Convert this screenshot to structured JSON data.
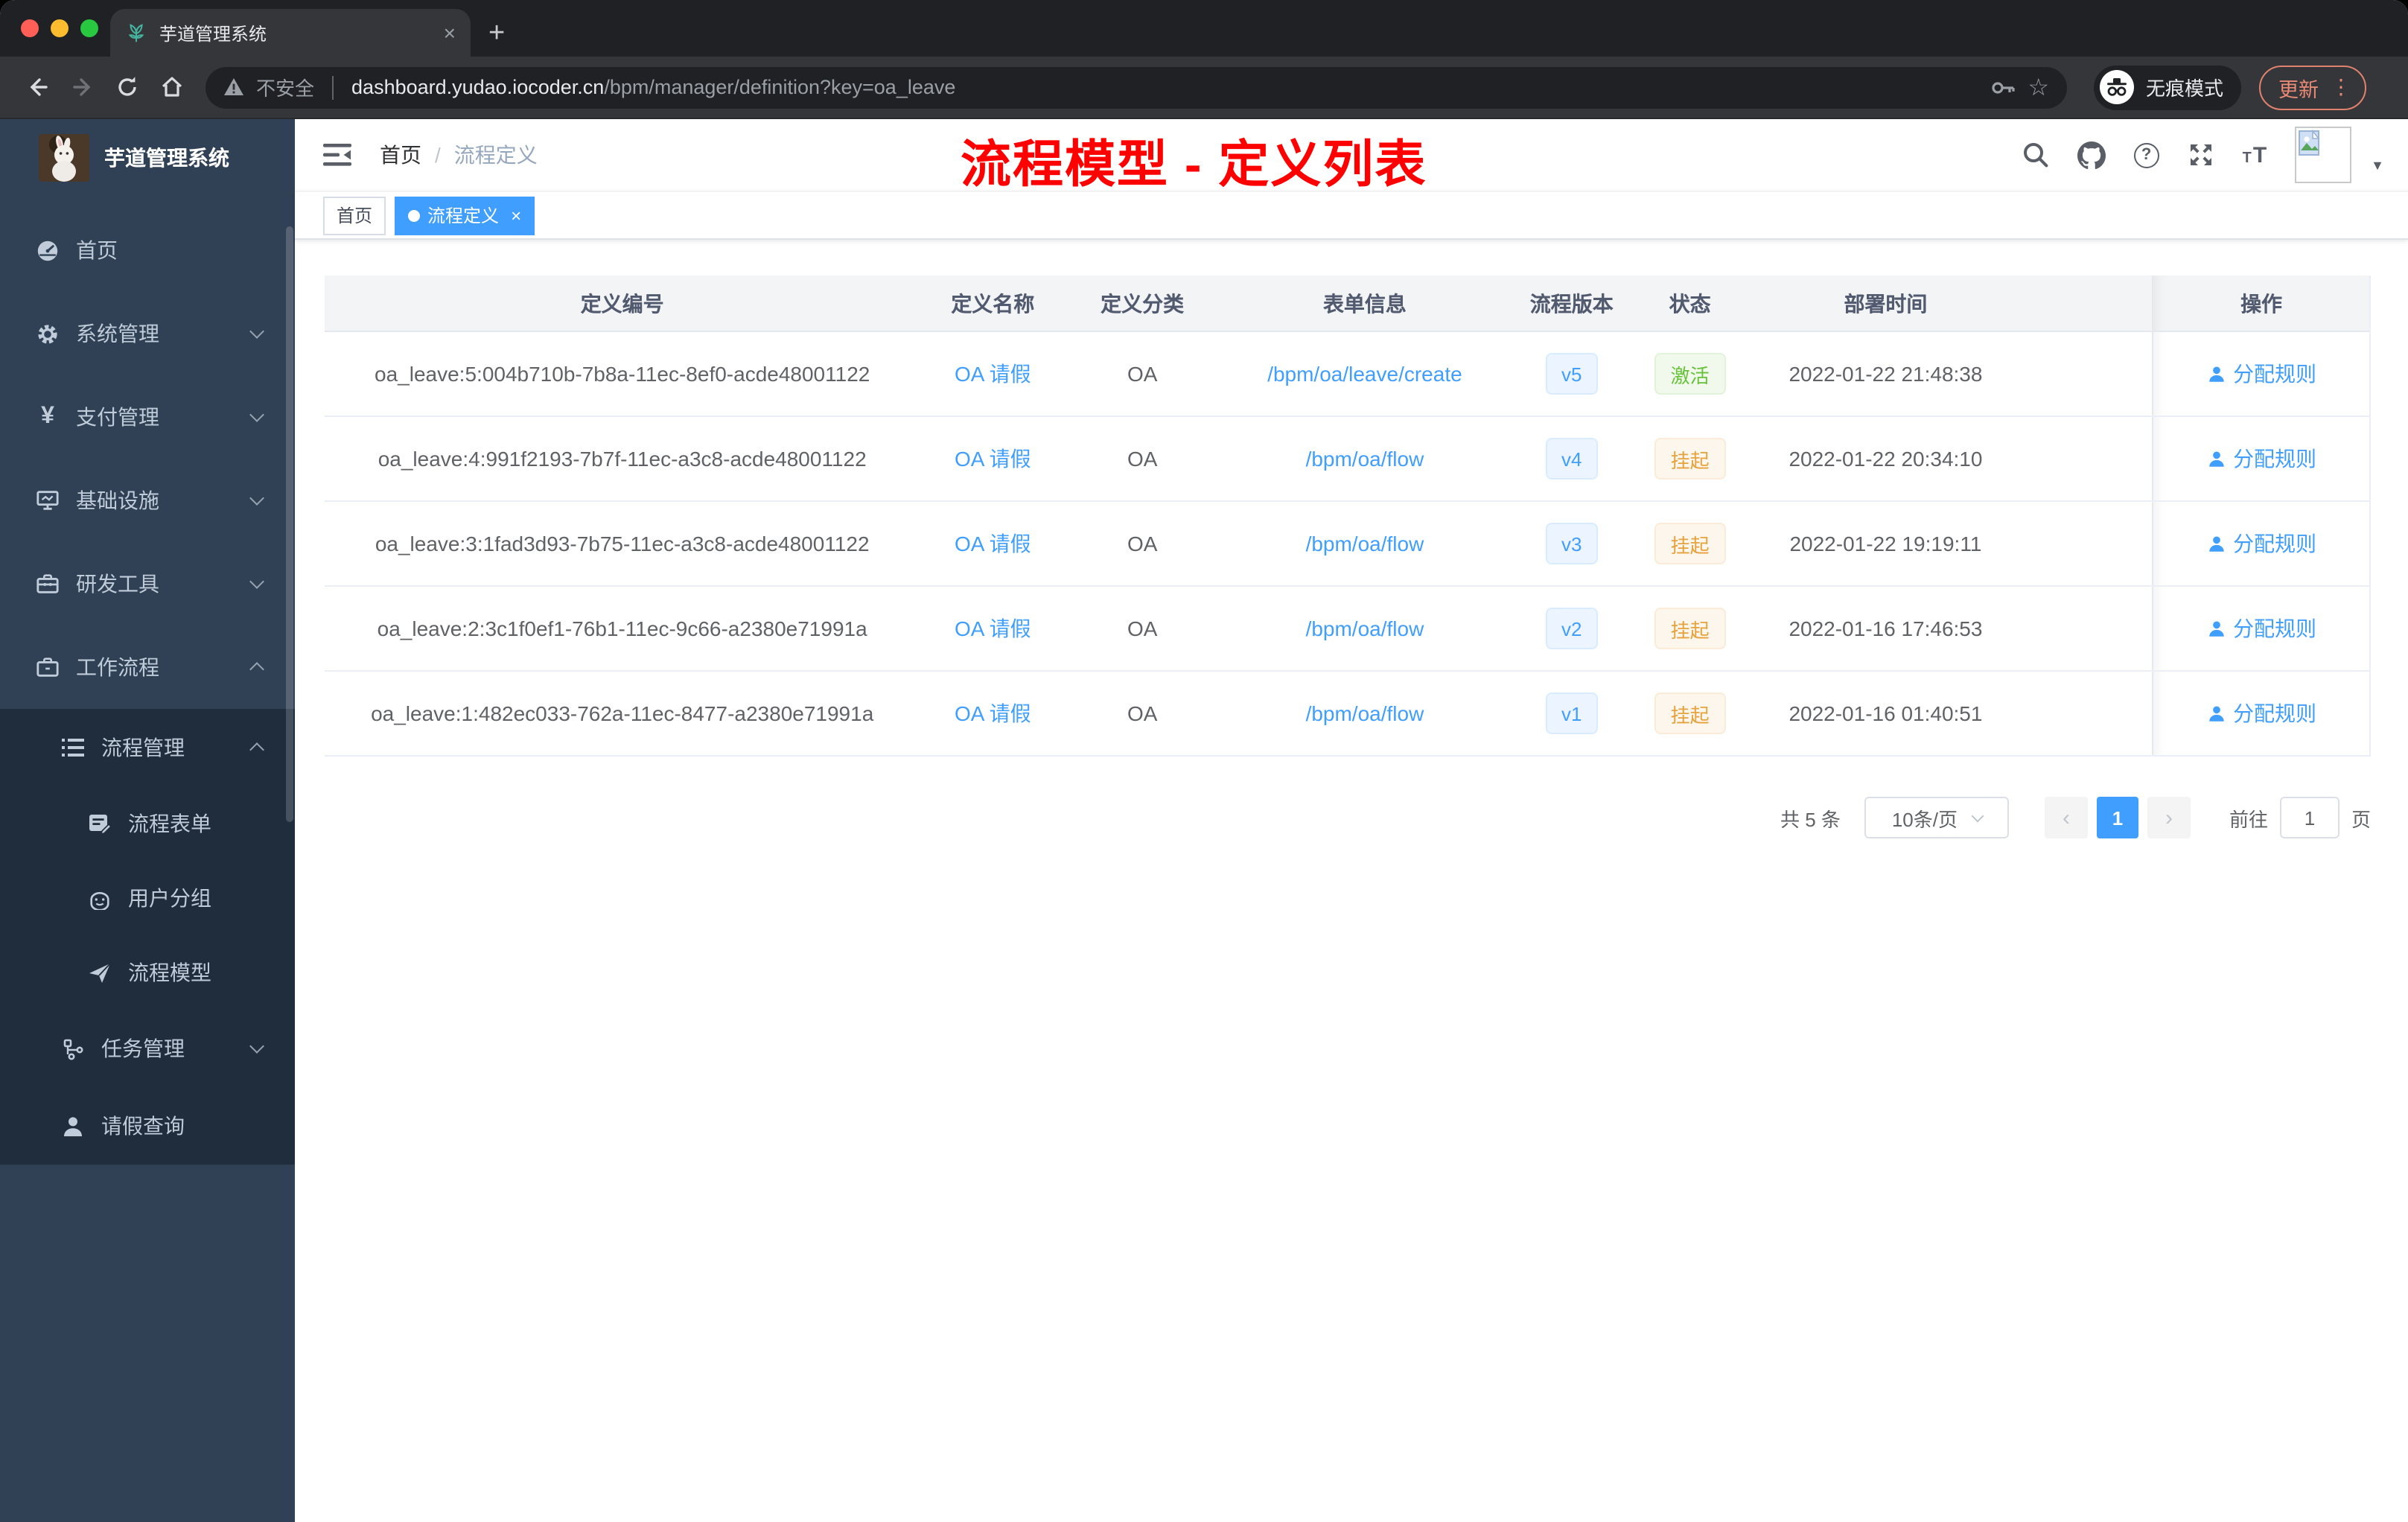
{
  "browser": {
    "tab_title": "芋道管理系统",
    "security_label": "不安全",
    "url_host": "dashboard.yudao.iocoder.cn",
    "url_path": "/bpm/manager/definition?key=oa_leave",
    "incognito_label": "无痕模式",
    "update_label": "更新"
  },
  "icons": {
    "close": "×",
    "plus": "+",
    "star": "☆",
    "menu_dots": "⋮",
    "caret_down": "▼",
    "page_prev": "‹",
    "page_next": "›"
  },
  "sidebar": {
    "title": "芋道管理系统",
    "menu": [
      {
        "label": "首页",
        "icon": "dashboard-icon"
      },
      {
        "label": "系统管理",
        "icon": "gear-icon",
        "chevron": "down"
      },
      {
        "label": "支付管理",
        "icon": "yen-icon",
        "chevron": "down"
      },
      {
        "label": "基础设施",
        "icon": "monitor-icon",
        "chevron": "down"
      },
      {
        "label": "研发工具",
        "icon": "toolbox-icon",
        "chevron": "down"
      },
      {
        "label": "工作流程",
        "icon": "briefcase-icon",
        "chevron": "up"
      },
      {
        "label": "流程管理",
        "icon": "list-icon",
        "chevron": "up"
      },
      {
        "label": "流程表单",
        "icon": "form-icon"
      },
      {
        "label": "用户分组",
        "icon": "people-icon"
      },
      {
        "label": "流程模型",
        "icon": "send-icon"
      },
      {
        "label": "任务管理",
        "icon": "tree-icon",
        "chevron": "down"
      },
      {
        "label": "请假查询",
        "icon": "user-icon"
      }
    ]
  },
  "header": {
    "breadcrumb_home": "首页",
    "breadcrumb_sep": "/",
    "breadcrumb_current": "流程定义",
    "annotation": "流程模型 - 定义列表"
  },
  "tags": {
    "home": "首页",
    "active": "流程定义"
  },
  "table": {
    "columns": [
      "定义编号",
      "定义名称",
      "定义分类",
      "表单信息",
      "流程版本",
      "状态",
      "部署时间",
      "操作"
    ],
    "rows": [
      {
        "id": "oa_leave:5:004b710b-7b8a-11ec-8ef0-acde48001122",
        "name": "OA 请假",
        "category": "OA",
        "form": "/bpm/oa/leave/create",
        "version": "v5",
        "status": "激活",
        "status_class": "pill pill-success",
        "time": "2022-01-22 21:48:38",
        "action": "分配规则"
      },
      {
        "id": "oa_leave:4:991f2193-7b7f-11ec-a3c8-acde48001122",
        "name": "OA 请假",
        "category": "OA",
        "form": "/bpm/oa/flow",
        "version": "v4",
        "status": "挂起",
        "status_class": "pill pill-warning",
        "time": "2022-01-22 20:34:10",
        "action": "分配规则"
      },
      {
        "id": "oa_leave:3:1fad3d93-7b75-11ec-a3c8-acde48001122",
        "name": "OA 请假",
        "category": "OA",
        "form": "/bpm/oa/flow",
        "version": "v3",
        "status": "挂起",
        "status_class": "pill pill-warning",
        "time": "2022-01-22 19:19:11",
        "action": "分配规则"
      },
      {
        "id": "oa_leave:2:3c1f0ef1-76b1-11ec-9c66-a2380e71991a",
        "name": "OA 请假",
        "category": "OA",
        "form": "/bpm/oa/flow",
        "version": "v2",
        "status": "挂起",
        "status_class": "pill pill-warning",
        "time": "2022-01-16 17:46:53",
        "action": "分配规则"
      },
      {
        "id": "oa_leave:1:482ec033-762a-11ec-8477-a2380e71991a",
        "name": "OA 请假",
        "category": "OA",
        "form": "/bpm/oa/flow",
        "version": "v1",
        "status": "挂起",
        "status_class": "pill pill-warning",
        "time": "2022-01-16 01:40:51",
        "action": "分配规则"
      }
    ]
  },
  "pagination": {
    "total": "共 5 条",
    "page_size": "10条/页",
    "current": "1",
    "goto_label": "前往",
    "goto_value": "1",
    "goto_unit": "页"
  },
  "colors": {
    "accent": "#409eff",
    "success": "#67c23a",
    "warning": "#e6a23c",
    "annotation_red": "#ff0000",
    "sidebar_bg": "#304156",
    "submenu_bg": "#1f2d3d",
    "tag_active_bg": "#409eff"
  }
}
